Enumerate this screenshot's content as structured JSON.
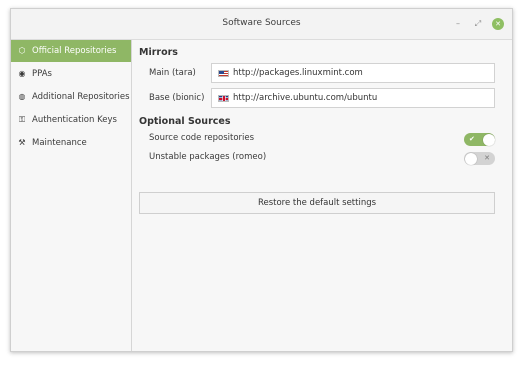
{
  "window": {
    "title": "Software Sources",
    "controls": {
      "minimize": "–",
      "maximize": "⤢",
      "close": "✕"
    }
  },
  "sidebar": {
    "items": [
      {
        "label": "Official Repositories",
        "icon": "package-icon",
        "glyph": "⬡",
        "active": true
      },
      {
        "label": "PPAs",
        "icon": "ppa-icon",
        "glyph": "◉",
        "active": false
      },
      {
        "label": "Additional Repositories",
        "icon": "globe-icon",
        "glyph": "◍",
        "active": false
      },
      {
        "label": "Authentication Keys",
        "icon": "key-icon",
        "glyph": "⚿",
        "active": false
      },
      {
        "label": "Maintenance",
        "icon": "maintenance-icon",
        "glyph": "⚒",
        "active": false
      }
    ]
  },
  "mirrors": {
    "heading": "Mirrors",
    "rows": [
      {
        "label": "Main (tara)",
        "value": "http://packages.linuxmint.com",
        "flag": "us-flag-icon"
      },
      {
        "label": "Base (bionic)",
        "value": "http://archive.ubuntu.com/ubuntu",
        "flag": "uk-flag-icon"
      }
    ]
  },
  "optional_sources": {
    "heading": "Optional Sources",
    "rows": [
      {
        "label": "Source code repositories",
        "enabled": true,
        "mark": "✔"
      },
      {
        "label": "Unstable packages (romeo)",
        "enabled": false,
        "mark": "✕"
      }
    ]
  },
  "restore_button": {
    "label": "Restore the default settings"
  },
  "colors": {
    "accent": "#8fb765",
    "sidebar_bg": "#f7f7f7",
    "content_bg": "#f7f7f7"
  }
}
